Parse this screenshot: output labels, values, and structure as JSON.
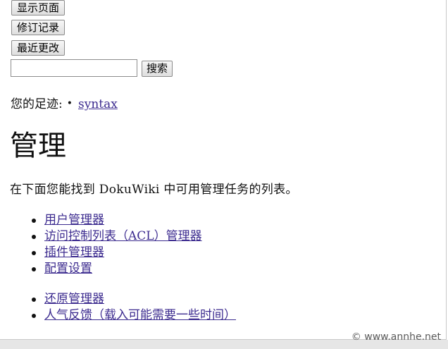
{
  "toolbar": {
    "show_page": "显示页面",
    "revisions": "修订记录",
    "recent_changes": "最近更改"
  },
  "search": {
    "value": "",
    "placeholder": "",
    "button": "搜索"
  },
  "breadcrumb": {
    "label": "您的足迹:",
    "bullet": "•",
    "items": [
      "syntax"
    ]
  },
  "main": {
    "title": "管理",
    "intro": "在下面您能找到 DokuWiki 中可用管理任务的列表。",
    "admin_links": [
      "用户管理器",
      "访问控制列表（ACL）管理器",
      "插件管理器",
      "配置设置"
    ],
    "extra_links": [
      "还原管理器",
      "人气反馈（载入可能需要一些时间）"
    ]
  },
  "watermark": "© www.annhe.net",
  "colors": {
    "link": "#3c2b8f",
    "text": "#111111",
    "background": "#ffffff"
  }
}
